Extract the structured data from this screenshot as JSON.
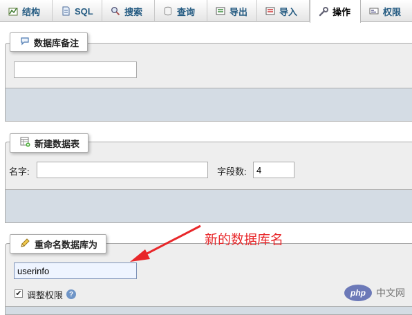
{
  "tabs": [
    {
      "label": "结构",
      "icon": "structure-icon"
    },
    {
      "label": "SQL",
      "icon": "sql-icon"
    },
    {
      "label": "搜索",
      "icon": "search-icon"
    },
    {
      "label": "查询",
      "icon": "query-icon"
    },
    {
      "label": "导出",
      "icon": "export-icon"
    },
    {
      "label": "导入",
      "icon": "import-icon"
    },
    {
      "label": "操作",
      "icon": "wrench-icon",
      "active": true
    },
    {
      "label": "权限",
      "icon": "privileges-icon"
    }
  ],
  "db_comment": {
    "legend": "数据库备注",
    "value": ""
  },
  "new_table": {
    "legend": "新建数据表",
    "name_label": "名字:",
    "name_value": "",
    "fields_label": "字段数:",
    "fields_value": "4"
  },
  "rename_db": {
    "legend": "重命名数据库为",
    "value": "userinfo",
    "adjust_privileges_label": "调整权限",
    "adjust_checked": true
  },
  "annotation": {
    "text": "新的数据库名",
    "color": "#e8272a"
  },
  "watermark": {
    "logo": "php",
    "text": "中文网"
  }
}
